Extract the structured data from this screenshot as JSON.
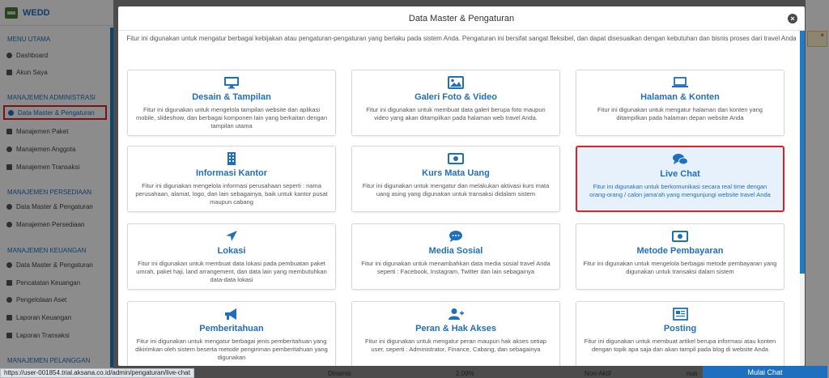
{
  "app": {
    "brand": "WEDD"
  },
  "sidebar": {
    "sections": [
      {
        "label": "MENU UTAMA"
      },
      {
        "label": "MANAJEMEN ADMINISTRASI"
      },
      {
        "label": "MANAJEMEN PERSEDIAAN"
      },
      {
        "label": "MANAJEMEN KEUANGAN"
      },
      {
        "label": "MANAJEMEN PELANGGAN"
      }
    ],
    "items": [
      {
        "label": "Dashboard"
      },
      {
        "label": "Akun Saya"
      },
      {
        "label": "Data Master & Pengaturan"
      },
      {
        "label": "Manajemen Paket"
      },
      {
        "label": "Manajemen Anggota"
      },
      {
        "label": "Manajemen Transaksi"
      },
      {
        "label": "Data Master & Pengaturan"
      },
      {
        "label": "Manajemen Persediaan"
      },
      {
        "label": "Data Master & Pengaturan"
      },
      {
        "label": "Pencatatan Keuangan"
      },
      {
        "label": "Pengelolaan Aset"
      },
      {
        "label": "Laporan Keuangan"
      },
      {
        "label": "Laporan Transaksi"
      }
    ]
  },
  "modal": {
    "title": "Data Master & Pengaturan",
    "close_label": "×",
    "intro": "Fitur ini digunakan untuk mengatur berbagai kebijakan atau pengaturan-pengaturan yang berlaku pada sistem Anda. Pengaturan ini bersifat sangat fleksibel, dan dapat disesuaikan dengan kebutuhan dan bisnis proses dari travel Anda",
    "cards": [
      {
        "title": "Desain & Tampilan",
        "icon": "monitor-icon",
        "desc": "Fitur ini digunakan untuk mengelola tampilan website dan aplikasi mobile, slideshow, dan berbagai komponen lain yang berkaitan dengan tampilan utama"
      },
      {
        "title": "Galeri Foto & Video",
        "icon": "image-icon",
        "desc": "Fitur ini digunakan untuk membuat data galeri berupa foto maupun video yang akan ditampilkan pada halaman web travel Anda."
      },
      {
        "title": "Halaman & Konten",
        "icon": "laptop-icon",
        "desc": "Fitur ini digunakan untuk mengatur halaman dan konten yang ditampilkan pada halaman depan website Anda"
      },
      {
        "title": "Informasi Kantor",
        "icon": "building-icon",
        "desc": "Fitur ini digunakan mengelola informasi perusahaan seperti : nama perusahaan, alamat, logo, dan lain sebagainya, baik untuk kantor pusat maupun cabang"
      },
      {
        "title": "Kurs Mata Uang",
        "icon": "money-icon",
        "desc": "Fitur ini digunakan untuk mengatur dan melakukan aktivasi kurs mata uang asing yang digunakan untuk transaksi didalam sistem"
      },
      {
        "title": "Live Chat",
        "icon": "chat-icon",
        "desc": "Fitur ini digunakan untuk berkomunikasi secara real time dengan orang-orang / calon jama'ah yang mengunjungi website travel Anda"
      },
      {
        "title": "Lokasi",
        "icon": "location-arrow-icon",
        "desc": "Fitur ini digunakan untuk membuat data lokasi pada pembuatan paket umrah, paket haji, land arrangement, dan data lain yang membutuhkan data-data lokasi"
      },
      {
        "title": "Media Sosial",
        "icon": "comment-dots-icon",
        "desc": "Fitur ini digunakan untuk menambahkan data media sosial travel Anda seperti : Facebook, Instagram, Twitter dan lain sebagainya"
      },
      {
        "title": "Metode Pembayaran",
        "icon": "money-icon",
        "desc": "Fitur ini digunakan untuk mengelola berbagai metode pembayaran yang digunakan untuk transaksi dalam sistem"
      },
      {
        "title": "Pemberitahuan",
        "icon": "megaphone-icon",
        "desc": "Fitur ini digunakan untuk mengatur berbagai jenis pemberitahuan yang dikirimkan oleh sistem beserta metode pengiriman pemberitahuan yang digunakan"
      },
      {
        "title": "Peran & Hak Akses",
        "icon": "user-plus-icon",
        "desc": "Fitur ini digunakan untuk mengatur peran maupun hak akses setiap user, seperti : Administrator, Finance, Cabang, dan sebagainya"
      },
      {
        "title": "Posting",
        "icon": "newspaper-icon",
        "desc": "Fitur ini digunakan untuk membuat artikel berupa informasi atau konten dengan topik apa saja dan akan tampil pada blog di website Anda"
      }
    ]
  },
  "statusbar": {
    "url": "https://user-001854.trial.aksana.co.id/admin/pengaturan/live-chat"
  },
  "background_row": {
    "col1": "Dinamis",
    "col2": "2.09%",
    "col3": "Non-Aktif",
    "col4": "nua"
  },
  "chat_button": {
    "label": "Mulai Chat"
  },
  "colors": {
    "accent": "#1f6fbf",
    "highlight_border": "#d8232a",
    "highlight_bg": "#e6f1fb"
  }
}
